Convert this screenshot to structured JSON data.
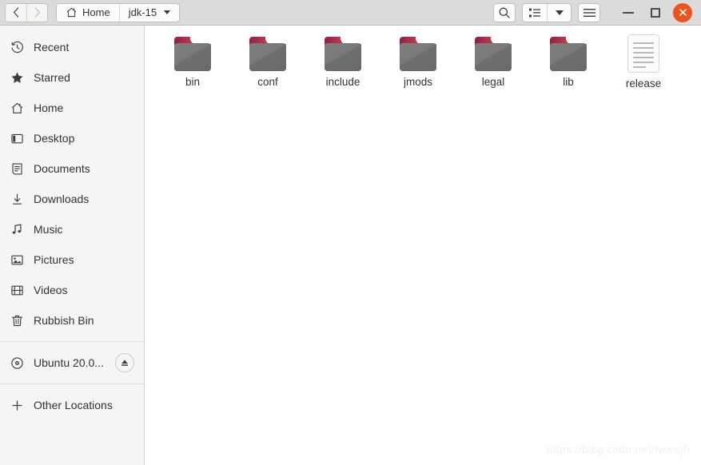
{
  "window": {
    "nav": {
      "back": "‹",
      "forward": "›"
    },
    "path": [
      {
        "label": "Home",
        "icon": "home-icon",
        "has_caret": false
      },
      {
        "label": "jdk-15",
        "icon": null,
        "has_caret": true
      }
    ],
    "toolbar": {
      "search_icon": "search-icon",
      "view_list_icon": "list-view-icon",
      "view_dropdown_icon": "chevron-down-icon",
      "menu_icon": "hamburger-menu-icon"
    },
    "controls": {
      "minimize": "minimize-icon",
      "maximize": "maximize-icon",
      "close": "close-icon",
      "close_color": "#e95420"
    }
  },
  "sidebar": {
    "items": [
      {
        "label": "Recent",
        "icon": "clock-icon"
      },
      {
        "label": "Starred",
        "icon": "star-icon"
      },
      {
        "label": "Home",
        "icon": "home-icon"
      },
      {
        "label": "Desktop",
        "icon": "desktop-icon"
      },
      {
        "label": "Documents",
        "icon": "document-icon"
      },
      {
        "label": "Downloads",
        "icon": "download-icon"
      },
      {
        "label": "Music",
        "icon": "music-note-icon"
      },
      {
        "label": "Pictures",
        "icon": "image-icon"
      },
      {
        "label": "Videos",
        "icon": "film-icon"
      },
      {
        "label": "Rubbish Bin",
        "icon": "trash-icon"
      }
    ],
    "devices": [
      {
        "label": "Ubuntu 20.0...",
        "icon": "disc-icon",
        "eject_icon": "eject-icon"
      }
    ],
    "other": {
      "label": "Other Locations",
      "icon": "plus-icon"
    }
  },
  "main": {
    "files": [
      {
        "name": "bin",
        "type": "folder"
      },
      {
        "name": "conf",
        "type": "folder"
      },
      {
        "name": "include",
        "type": "folder"
      },
      {
        "name": "jmods",
        "type": "folder"
      },
      {
        "name": "legal",
        "type": "folder"
      },
      {
        "name": "lib",
        "type": "folder"
      },
      {
        "name": "release",
        "type": "text-file"
      }
    ]
  },
  "watermark": "https://blog.csdn.net/twxwjh"
}
